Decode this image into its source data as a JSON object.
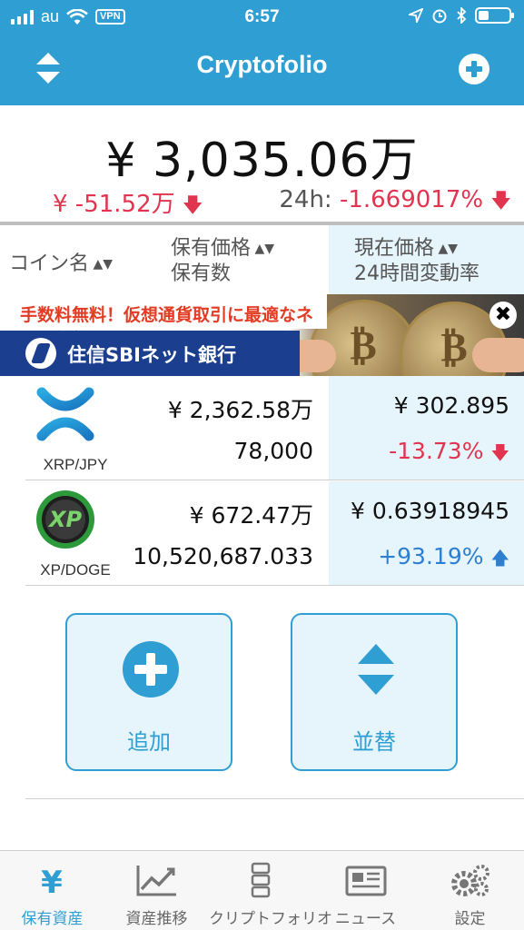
{
  "status_bar": {
    "carrier": "au",
    "vpn": "VPN",
    "time": "6:57",
    "battery_level": 0.35
  },
  "nav": {
    "title": "Cryptofolio",
    "left_icon": "sort-updown-icon",
    "right_icon": "plus-circle-icon"
  },
  "summary": {
    "total": "¥ 3,035.06万",
    "change": "¥ -51.52万",
    "change_24h_label": "24h:",
    "change_24h_value": "-1.669017%"
  },
  "table_header": {
    "coin_name": "コイン名",
    "held_value": "保有価格",
    "held_qty": "保有数",
    "current_price": "現在価格",
    "change_24h": "24時間変動率"
  },
  "ad": {
    "headline": "手数料無料！仮想通貨取引に最適なネット銀行！",
    "bank_name": "住信SBIネット銀行",
    "close": "✖"
  },
  "holdings": [
    {
      "pair": "XRP/JPY",
      "icon": "xrp-icon",
      "held_value": "¥ 2,362.58万",
      "held_qty": "78,000",
      "price": "¥ 302.895",
      "change": "-13.73%",
      "direction": "down"
    },
    {
      "pair": "XP/DOGE",
      "icon": "xp-icon",
      "held_value": "¥ 672.47万",
      "held_qty": "10,520,687.033",
      "price": "¥ 0.63918945",
      "change": "+93.19%",
      "direction": "up"
    }
  ],
  "actions": {
    "add": "追加",
    "sort": "並替"
  },
  "tabs": [
    {
      "label": "保有資産",
      "icon": "yen-icon",
      "active": true
    },
    {
      "label": "資産推移",
      "icon": "chart-icon",
      "active": false
    },
    {
      "label": "クリプトフォリオ",
      "icon": "blockchain-icon",
      "active": false
    },
    {
      "label": "ニュース",
      "icon": "newspaper-icon",
      "active": false
    },
    {
      "label": "設定",
      "icon": "gears-icon",
      "active": false
    }
  ],
  "colors": {
    "accent": "#2f9fd3",
    "negative": "#e0344f",
    "positive": "#2f7fd0",
    "highlight_column": "#e6f4fb"
  }
}
